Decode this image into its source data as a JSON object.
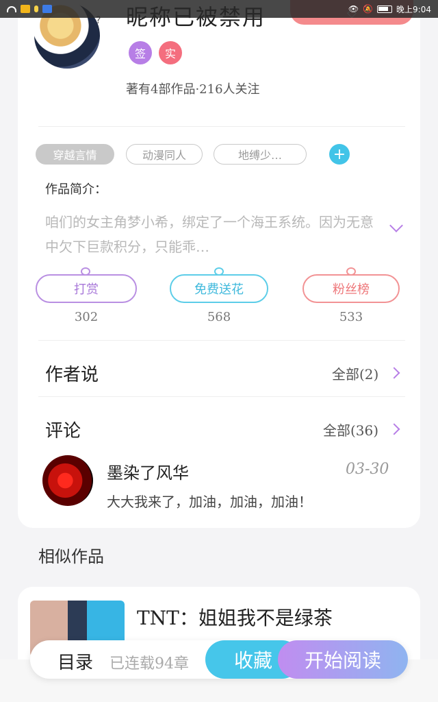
{
  "status_bar": {
    "time": "晚上9:04"
  },
  "author": {
    "nickname": "昵称已被禁用",
    "avatar_mark": "?",
    "badges": [
      "签",
      "实"
    ],
    "stats": "著有4部作品·216人关注"
  },
  "tags": [
    "穿越言情",
    "动漫同人",
    "地缚少…"
  ],
  "intro": {
    "title": "作品简介：",
    "body": "咱们的女主角梦小希，绑定了一个海王系统。因为无意中欠下巨款积分，只能乖…"
  },
  "actions": [
    {
      "label": "打赏",
      "count": "302",
      "color": "#a878d9"
    },
    {
      "label": "免费送花",
      "count": "568",
      "color": "#3fb9dc"
    },
    {
      "label": "粉丝榜",
      "count": "533",
      "color": "#ee7679"
    }
  ],
  "author_says": {
    "title": "作者说",
    "more": "全部(2)"
  },
  "comments": {
    "title": "评论",
    "more": "全部(36)",
    "items": [
      {
        "user": "墨染了风华",
        "date": "03-30",
        "text": "大大我来了，加油，加油，加油！"
      }
    ]
  },
  "similar": {
    "title": "相似作品",
    "items": [
      {
        "title": "TNT：姐姐我不是绿茶"
      }
    ]
  },
  "bottom_bar": {
    "toc_label": "目录",
    "serial_status": "已连载94章",
    "collect_label": "收藏",
    "read_label": "开始阅读"
  }
}
